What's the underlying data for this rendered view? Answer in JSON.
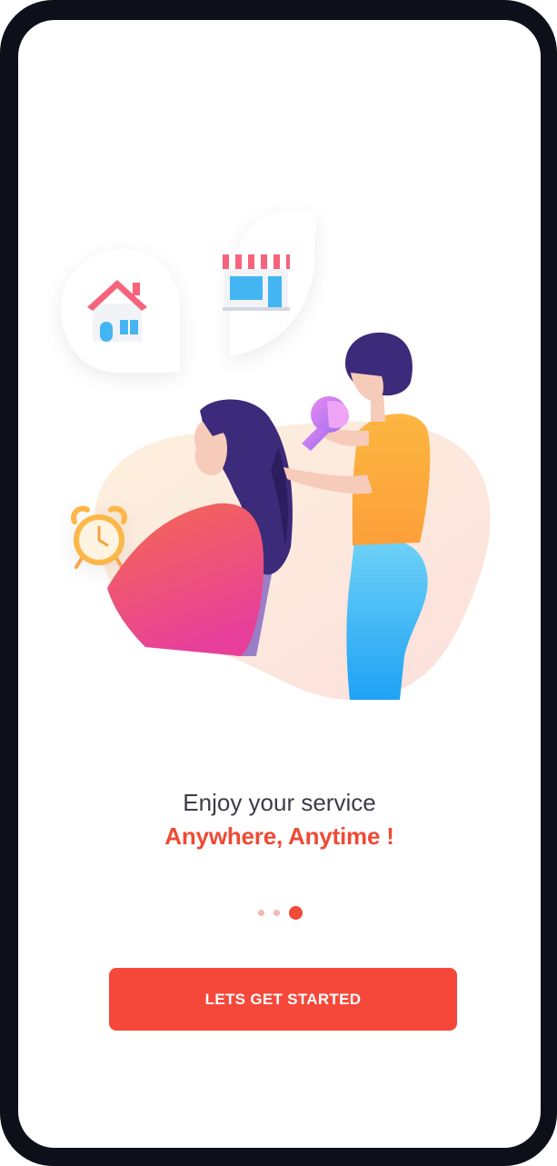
{
  "onboarding": {
    "headline": "Enjoy your service",
    "tagline": "Anywhere, Anytime !",
    "page_indicator": {
      "total": 3,
      "active": 3
    },
    "cta_label": "LETS GET STARTED"
  },
  "illustration_icons": [
    "home-icon",
    "storefront-icon",
    "alarm-clock-icon",
    "hair-dryer-icon"
  ],
  "colors": {
    "accent": "#F5483A",
    "tagline": "#EE4A35",
    "headline": "#3C3C46",
    "device_frame": "#0D1018",
    "dot_inactive": "#F5B7AE"
  }
}
